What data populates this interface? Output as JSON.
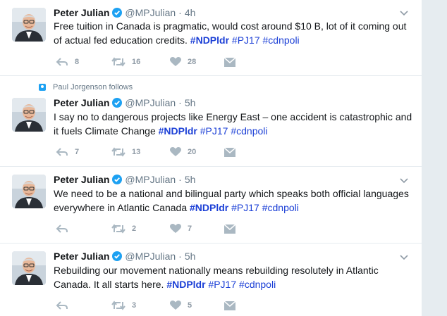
{
  "colors": {
    "link": "#1b3fd6",
    "muted": "#657786",
    "icon": "#aab8c2",
    "verified": "#1da1f2",
    "background": "#e6ecf0"
  },
  "tweets": [
    {
      "context": "",
      "author_name": "Peter Julian",
      "author_handle": "@MPJulian",
      "dot": "·",
      "time": "4h",
      "text": "Free tuition in Canada is pragmatic, would cost around $10 B, lot of it coming out of actual fed education credits.",
      "hashtags": [
        "#NDPldr",
        "#PJ17",
        "#cdnpoli"
      ],
      "reply_count": "8",
      "retweet_count": "16",
      "like_count": "28"
    },
    {
      "context": "Paul Jorgenson follows",
      "author_name": "Peter Julian",
      "author_handle": "@MPJulian",
      "dot": "·",
      "time": "5h",
      "text": "I say no to dangerous projects like Energy East – one accident is catastrophic and it fuels Climate Change",
      "hashtags": [
        "#NDPldr",
        "#PJ17",
        "#cdnpoli"
      ],
      "reply_count": "7",
      "retweet_count": "13",
      "like_count": "20"
    },
    {
      "context": "",
      "author_name": "Peter Julian",
      "author_handle": "@MPJulian",
      "dot": "·",
      "time": "5h",
      "text": "We need to be a national and bilingual party which speaks both official languages everywhere in Atlantic Canada",
      "hashtags": [
        "#NDPldr",
        "#PJ17",
        "#cdnpoli"
      ],
      "reply_count": "",
      "retweet_count": "2",
      "like_count": "7"
    },
    {
      "context": "",
      "author_name": "Peter Julian",
      "author_handle": "@MPJulian",
      "dot": "·",
      "time": "5h",
      "text": "Rebuilding our movement nationally means rebuilding resolutely in Atlantic Canada. It all starts here.",
      "hashtags": [
        "#NDPldr",
        "#PJ17",
        "#cdnpoli"
      ],
      "reply_count": "",
      "retweet_count": "3",
      "like_count": "5"
    }
  ],
  "icons": {
    "context": "person-follow-icon",
    "verified": "verified-badge-icon",
    "menu": "chevron-down-icon",
    "reply": "reply-icon",
    "retweet": "retweet-icon",
    "like": "heart-icon",
    "dm": "envelope-icon"
  }
}
